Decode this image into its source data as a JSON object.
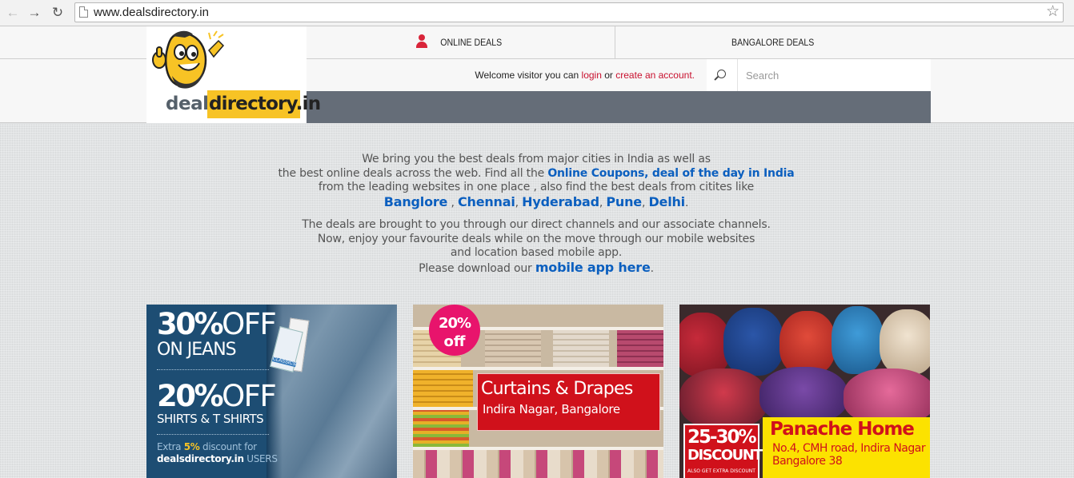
{
  "browser": {
    "url": "www.dealsdirectory.in"
  },
  "header": {
    "logo": {
      "text_part1": "deals",
      "text_part2": "directory.in"
    },
    "tabs": [
      {
        "label": "ONLINE DEALS"
      },
      {
        "label": "BANGALORE DEALS"
      }
    ],
    "welcome": {
      "prefix": "Welcome visitor you can",
      "login_link": "login",
      "or": "or",
      "create_link": "create an account."
    },
    "search": {
      "placeholder": "Search"
    }
  },
  "intro": {
    "p1_line1": "We bring you the best deals from major cities in India as well as",
    "p1_line2_prefix": "the best online deals across the web. Find all the",
    "p1_line2_link": "Online Coupons, deal of the day in India",
    "p1_line3": "from the leading websites in one place , also find the best deals from citites like",
    "cities": [
      "Banglore",
      "Chennai",
      "Hyderabad",
      "Pune",
      "Delhi"
    ],
    "p2_line1": "The deals are brought to you through our direct channels and our associate channels.",
    "p2_line2": "Now, enjoy your favourite deals while on the move through our mobile websites",
    "p2_line3": "and location based mobile app.",
    "p2_line4_prefix": "Please download our",
    "p2_line4_link": "mobile app here"
  },
  "deals": [
    {
      "offer1_pct": "30%",
      "offer1_word": "OFF",
      "offer1_item": "ON JEANS",
      "offer2_pct": "20%",
      "offer2_word": "OFF",
      "offer2_item": "SHIRTS & T SHIRTS",
      "extra_prefix": "Extra",
      "extra_pct": "5%",
      "extra_suffix": "discount  for",
      "extra_site": "dealsdirectory.in",
      "extra_users": "USERS",
      "tag_text": "CLASSICS"
    },
    {
      "badge_line1": "20%",
      "badge_line2": "off",
      "title": "Curtains & Drapes",
      "location": "Indira Nagar, Bangalore"
    },
    {
      "discount_pct": "25-30%",
      "discount_word": "DISCOUNT",
      "small_text": "ALSO GET EXTRA DISCOUNT",
      "title": "Panache Home",
      "address1": "No.4, CMH road, Indira Nagar",
      "address2": "Bangalore 38"
    }
  ],
  "colors": {
    "brand_yellow": "#f7c325",
    "link_red": "#c8102e",
    "link_blue": "#0b5fbf",
    "header_band": "#656d78"
  }
}
